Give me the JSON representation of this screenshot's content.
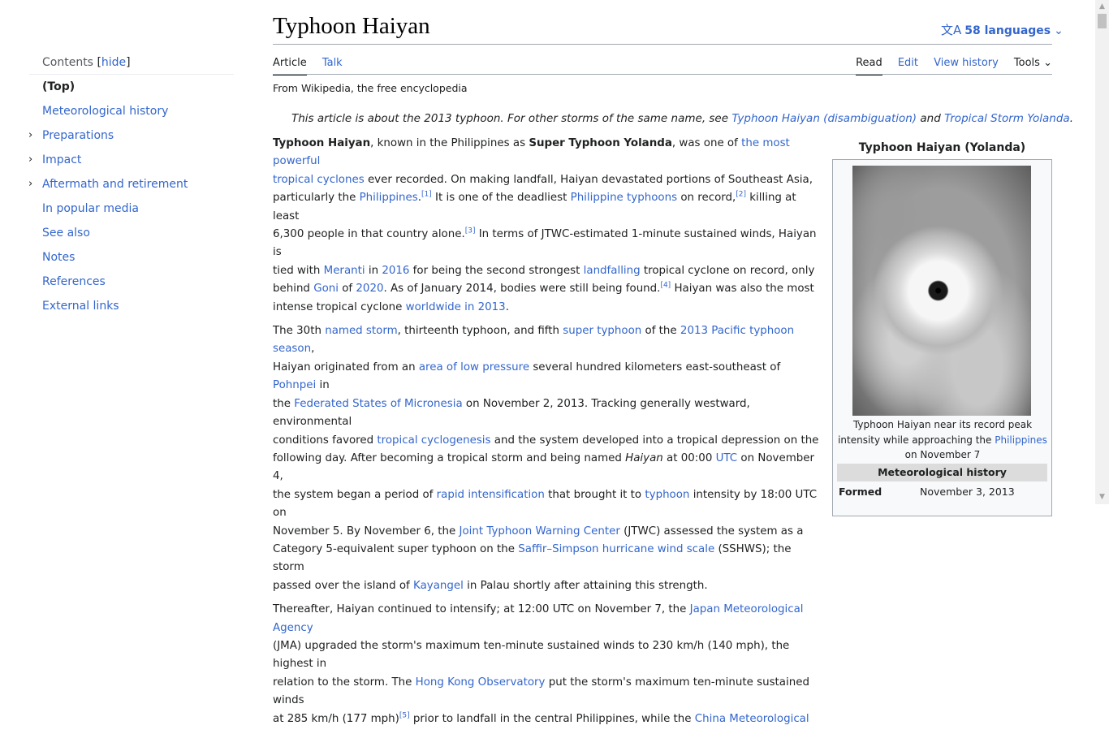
{
  "header": {
    "title": "Typhoon Haiyan",
    "languages": {
      "icon": "translate-icon",
      "label": "58 languages"
    },
    "tabs_left": [
      {
        "label": "Article",
        "active": true
      },
      {
        "label": "Talk"
      }
    ],
    "tabs_right": [
      {
        "label": "Read",
        "active": true
      },
      {
        "label": "Edit"
      },
      {
        "label": "View history"
      },
      {
        "label": "Tools"
      }
    ]
  },
  "toc": {
    "title": "Contents",
    "hide_label": "hide",
    "items": [
      {
        "label": "(Top)"
      },
      {
        "label": "Meteorological history"
      },
      {
        "label": "Preparations"
      },
      {
        "label": "Impact"
      },
      {
        "label": "Aftermath and retirement"
      },
      {
        "label": "In popular media"
      },
      {
        "label": "See also"
      },
      {
        "label": "Notes"
      },
      {
        "label": "References"
      },
      {
        "label": "External links"
      }
    ]
  },
  "tagline": "From Wikipedia, the free encyclopedia",
  "hatnote": {
    "prefix": "This article is about the 2013 typhoon. For other storms of the same name, see ",
    "link1": "Typhoon Haiyan (disambiguation)",
    "middle": " and ",
    "link2": "Tropical Storm Yolanda",
    "suffix": "."
  },
  "infobox": {
    "title": "Typhoon Haiyan (Yolanda)",
    "image_alt": "satellite image of typhoon",
    "caption_1": "Typhoon Haiyan near its record peak intensity while approaching the ",
    "caption_link": "Philippines",
    "caption_2": " on November 7",
    "section": "Meteorological history",
    "row_key": "Formed",
    "row_value": "November 3, 2013"
  },
  "colors": {
    "link": "#3366cc",
    "text": "#202122",
    "border": "#a2a9b1"
  }
}
